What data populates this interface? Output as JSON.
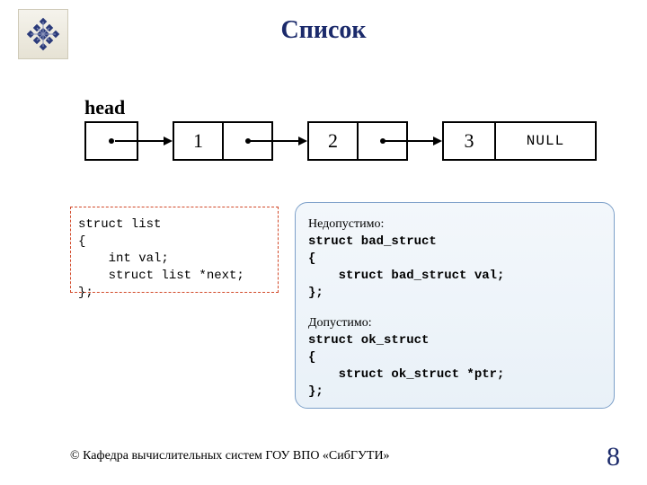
{
  "title": "Список",
  "head_label": "head",
  "diagram": {
    "node1": "1",
    "node2": "2",
    "node3": "3",
    "null": "NULL"
  },
  "left_code": "struct list\n{\n    int val;\n    struct list *next;\n};",
  "right_panel": {
    "bad_header": "Недопустимо:",
    "bad_code": "struct bad_struct\n{\n    struct bad_struct val;\n};",
    "ok_header": "Допустимо:",
    "ok_code": "struct ok_struct\n{\n    struct ok_struct *ptr;\n};"
  },
  "copyright": "© Кафедра вычислительных систем ГОУ ВПО «СибГУТИ»",
  "page_number": "8"
}
